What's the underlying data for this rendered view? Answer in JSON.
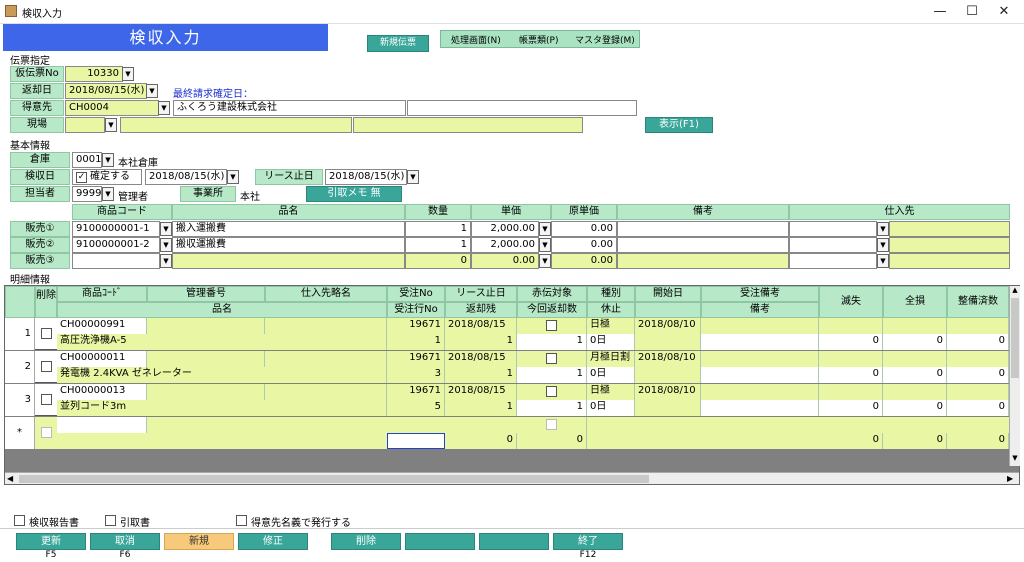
{
  "window": {
    "title": "検収入力",
    "min": "—",
    "max": "☐",
    "close": "✕"
  },
  "banner": "検収入力",
  "toolbar": {
    "new_slip": "新規伝票",
    "process": "処理画面(N)",
    "forms": "帳票類(P)",
    "master": "マスタ登録(M)"
  },
  "slip": {
    "section": "伝票指定",
    "temp_no_label": "仮伝票No",
    "temp_no": "10330",
    "return_date_label": "返却日",
    "return_date": "2018/08/15(水)",
    "last_billing_label": "最終請求確定日：",
    "customer_label": "得意先",
    "customer_code": "CH0004",
    "customer_name": "ふくろう建設株式会社",
    "site_label": "現場",
    "show_button": "表示(F1)"
  },
  "basic": {
    "section": "基本情報",
    "warehouse_label": "倉庫",
    "warehouse_code": "0001",
    "warehouse_name": "本社倉庫",
    "inspect_date_label": "検収日",
    "confirm_label": "確定する",
    "inspect_date": "2018/08/15(水)",
    "lease_stop_label": "リース止日",
    "lease_stop": "2018/08/15(水)",
    "staff_label": "担当者",
    "staff_code": "9999",
    "staff_name": "管理者",
    "office_label": "事業所",
    "office": "本社",
    "memo_button": "引取メモ 無"
  },
  "sales": {
    "headers": [
      "商品コード",
      "品名",
      "数量",
      "単価",
      "原単価",
      "備考",
      "仕入先"
    ],
    "rows": [
      {
        "label": "販売①",
        "code": "9100000001-1",
        "name": "搬入運搬費",
        "qty": "1",
        "price": "2,000.00",
        "cost": "0.00"
      },
      {
        "label": "販売②",
        "code": "9100000001-2",
        "name": "搬収運搬費",
        "qty": "1",
        "price": "2,000.00",
        "cost": "0.00"
      },
      {
        "label": "販売③",
        "code": "",
        "name": "",
        "qty": "0",
        "price": "0.00",
        "cost": "0.00"
      }
    ]
  },
  "detail": {
    "section": "明細情報",
    "h_delete": "削除",
    "h1": [
      "商品ｺｰﾄﾞ",
      "管理番号",
      "仕入先略名",
      "受注No",
      "リース止日",
      "赤伝対象",
      "種別",
      "開始日",
      "受注備考"
    ],
    "h2": [
      "品名",
      "受注行No",
      "返却残",
      "今回返却数",
      "休止",
      "備考"
    ],
    "h_extra": [
      "滅失",
      "全損",
      "整備済数"
    ],
    "rows": [
      {
        "no": "1",
        "code": "CH00000991",
        "name": "高圧洗浄機A-5",
        "order_no": "19671",
        "line_no": "1",
        "lease_stop": "2018/08/15",
        "remain": "1",
        "ret": "1",
        "type": "日極",
        "pause": "0日",
        "start": "2018/08/10",
        "loss": "0",
        "total": "0",
        "maint": "0"
      },
      {
        "no": "2",
        "code": "CH00000011",
        "name": "発電機 2.4KVA ゼネレーター",
        "order_no": "19671",
        "line_no": "3",
        "lease_stop": "2018/08/15",
        "remain": "1",
        "ret": "1",
        "type": "月極日割",
        "pause": "0日",
        "start": "2018/08/10",
        "loss": "0",
        "total": "0",
        "maint": "0"
      },
      {
        "no": "3",
        "code": "CH00000013",
        "name": "並列コード3m",
        "order_no": "19671",
        "line_no": "5",
        "lease_stop": "2018/08/15",
        "remain": "1",
        "ret": "1",
        "type": "日極",
        "pause": "0日",
        "start": "2018/08/10",
        "loss": "0",
        "total": "0",
        "maint": "0"
      }
    ],
    "new_row": {
      "marker": "*",
      "remain": "0",
      "ret": "0",
      "loss": "0",
      "total": "0",
      "maint": "0"
    }
  },
  "print": {
    "report": "検収報告書",
    "pickup": "引取書",
    "issue": "得意先名義で発行する"
  },
  "fkeys": [
    {
      "label": "更新",
      "key": "F5"
    },
    {
      "label": "取消",
      "key": "F6"
    },
    {
      "label": "新規",
      "key": ""
    },
    {
      "label": "修正",
      "key": ""
    },
    {
      "label": "削除",
      "key": ""
    },
    {
      "label": "",
      "key": ""
    },
    {
      "label": "",
      "key": ""
    },
    {
      "label": "終了",
      "key": "F12"
    }
  ]
}
